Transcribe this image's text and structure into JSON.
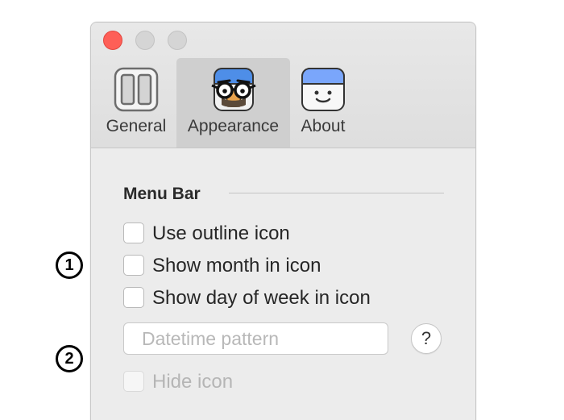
{
  "window": {
    "traffic_lights": {
      "close": "red-close",
      "minimize": "gray-minimize",
      "zoom": "gray-zoom"
    }
  },
  "tabs": [
    {
      "label": "General",
      "icon": "panels-icon",
      "selected": false
    },
    {
      "label": "Appearance",
      "icon": "disguise-face-icon",
      "selected": true
    },
    {
      "label": "About",
      "icon": "smiley-calendar-icon",
      "selected": false
    }
  ],
  "section": {
    "title": "Menu Bar"
  },
  "options": [
    {
      "label": "Use outline icon",
      "checked": false,
      "enabled": true
    },
    {
      "label": "Show month in icon",
      "checked": false,
      "enabled": true
    },
    {
      "label": "Show day of week in icon",
      "checked": false,
      "enabled": true
    }
  ],
  "pattern": {
    "placeholder": "Datetime pattern",
    "value": ""
  },
  "help": {
    "label": "?"
  },
  "hide_icon": {
    "label": "Hide icon",
    "checked": false,
    "enabled": false
  },
  "annotations": [
    "1",
    "2"
  ],
  "colors": {
    "close_light": "#fe5f57",
    "selected_tab": "#cfcfcf",
    "window_bg": "#ececec",
    "calendar_header": "#5b8cf5"
  }
}
